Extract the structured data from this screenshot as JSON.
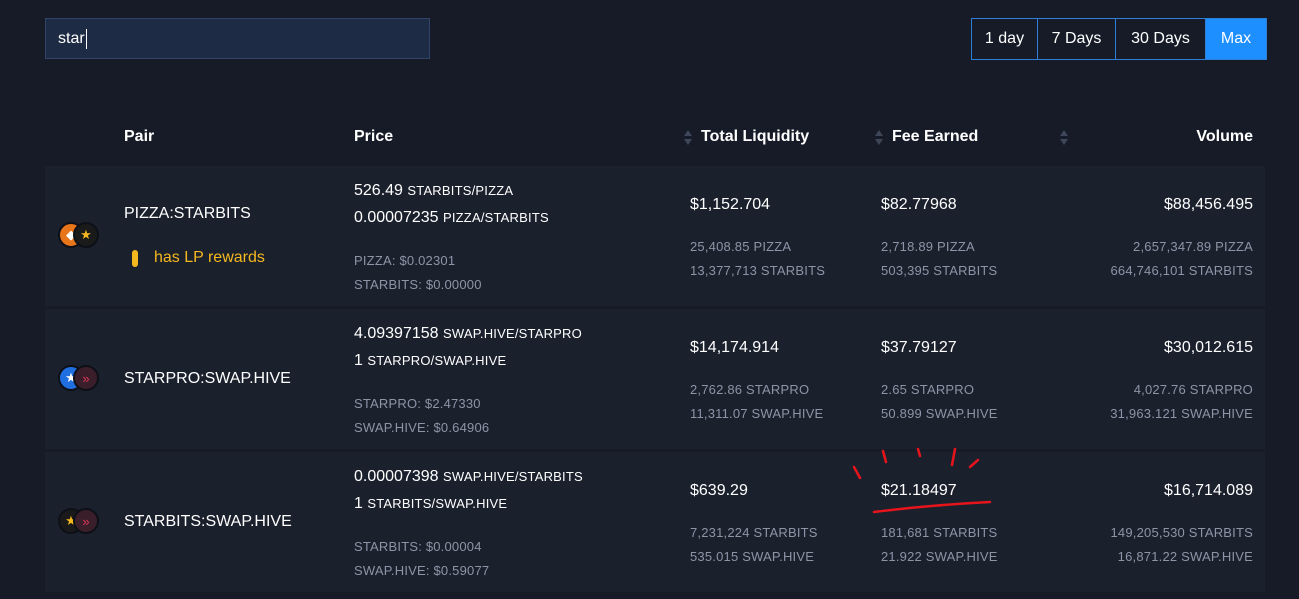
{
  "search": {
    "value": "star"
  },
  "ranges": [
    {
      "label": "1 day",
      "active": false
    },
    {
      "label": "7 Days",
      "active": false
    },
    {
      "label": "30 Days",
      "active": false
    },
    {
      "label": "Max",
      "active": true
    }
  ],
  "columns": {
    "pair": "Pair",
    "price": "Price",
    "liquidity": "Total Liquidity",
    "fee": "Fee Earned",
    "volume": "Volume"
  },
  "rows": [
    {
      "pair": "PIZZA:STARBITS",
      "lp_rewards": "has LP rewards",
      "price1": {
        "value": "526.49",
        "unit": "STARBITS/PIZZA"
      },
      "price2": {
        "value": "0.00007235",
        "unit": "PIZZA/STARBITS"
      },
      "token_price1": "PIZZA: $0.02301",
      "token_price2": "STARBITS: $0.00000",
      "liquidity": "$1,152.704",
      "liquidity_a": "25,408.85 PIZZA",
      "liquidity_b": "13,377,713 STARBITS",
      "fee": "$82.77968",
      "fee_a": "2,718.89 PIZZA",
      "fee_b": "503,395 STARBITS",
      "volume": "$88,456.495",
      "volume_a": "2,657,347.89 PIZZA",
      "volume_b": "664,746,101 STARBITS",
      "icons": [
        "pizza-icon",
        "starbits-icon"
      ]
    },
    {
      "pair": "STARPRO:SWAP.HIVE",
      "price1": {
        "value": "4.09397158",
        "unit": "SWAP.HIVE/STARPRO"
      },
      "price2": {
        "value": "1",
        "unit": "STARPRO/SWAP.HIVE"
      },
      "token_price1": "STARPRO: $2.47330",
      "token_price2": "SWAP.HIVE: $0.64906",
      "liquidity": "$14,174.914",
      "liquidity_a": "2,762.86 STARPRO",
      "liquidity_b": "11,311.07 SWAP.HIVE",
      "fee": "$37.79127",
      "fee_a": "2.65 STARPRO",
      "fee_b": "50.899 SWAP.HIVE",
      "volume": "$30,012.615",
      "volume_a": "4,027.76 STARPRO",
      "volume_b": "31,963.121 SWAP.HIVE",
      "icons": [
        "starpro-icon",
        "swap-hive-icon"
      ]
    },
    {
      "pair": "STARBITS:SWAP.HIVE",
      "price1": {
        "value": "0.00007398",
        "unit": "SWAP.HIVE/STARBITS"
      },
      "price2": {
        "value": "1",
        "unit": "STARBITS/SWAP.HIVE"
      },
      "token_price1": "STARBITS: $0.00004",
      "token_price2": "SWAP.HIVE: $0.59077",
      "liquidity": "$639.29",
      "liquidity_a": "7,231,224 STARBITS",
      "liquidity_b": "535.015 SWAP.HIVE",
      "fee": "$21.18497",
      "fee_a": "181,681 STARBITS",
      "fee_b": "21.922 SWAP.HIVE",
      "volume": "$16,714.089",
      "volume_a": "149,205,530 STARBITS",
      "volume_b": "16,871.22 SWAP.HIVE",
      "icons": [
        "starbits-icon",
        "swap-hive-icon"
      ]
    }
  ],
  "colors": {
    "background": "#161b27",
    "row": "#1b202d",
    "accent": "#1d8fff",
    "lp": "#f5b81e",
    "annotation": "#e8141c"
  }
}
